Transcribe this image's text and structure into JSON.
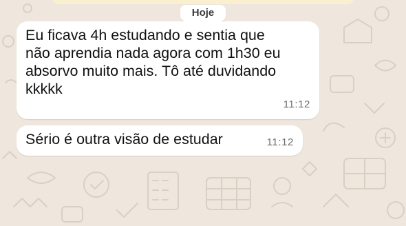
{
  "chat": {
    "date_separator": "Hoje",
    "messages": [
      {
        "lines": [
          "Eu ficava 4h estudando e sentia que",
          "não aprendia nada agora com 1h30 eu",
          "absorvo muito mais. Tô até duvidando",
          "kkkkk"
        ],
        "time": "11:12"
      },
      {
        "lines": [
          "Sério é outra visão de estudar"
        ],
        "time": "11:12"
      }
    ]
  },
  "colors": {
    "wallpaper": "#efe7de",
    "bubble_incoming": "#ffffff",
    "banner": "#fbefcd",
    "timestamp": "#6d6d6d"
  },
  "icons": [
    "doodle-wallpaper-pattern"
  ]
}
